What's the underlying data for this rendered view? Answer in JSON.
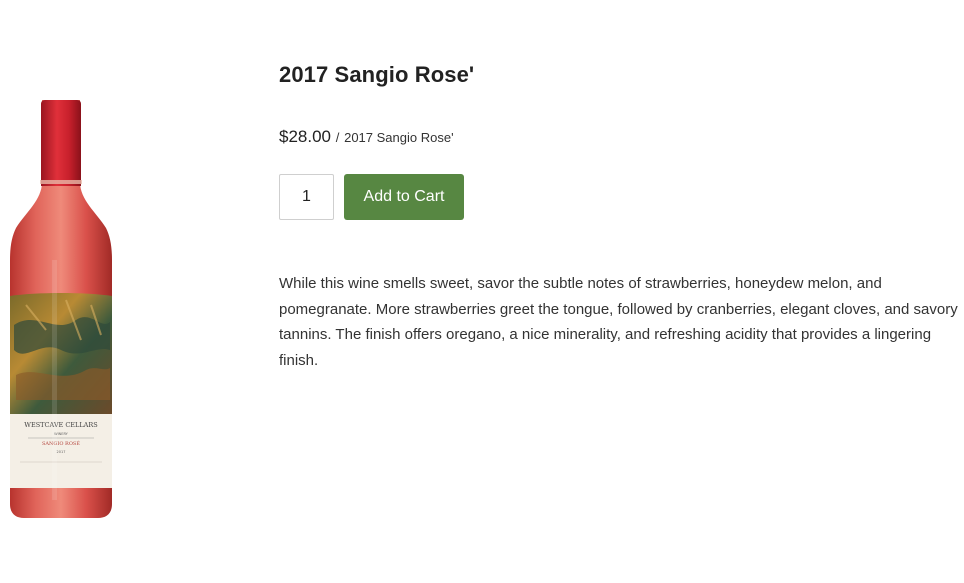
{
  "product": {
    "title": "2017 Sangio Rose'",
    "price": "$28.00",
    "price_separator": "/",
    "price_unit": "2017 Sangio Rose'",
    "quantity": "1",
    "add_to_cart_label": "Add to Cart",
    "description": "While this wine smells sweet, savor the subtle notes of strawberries, honeydew melon, and pomegranate. More strawberries greet the tongue, followed by cranberries, elegant cloves, and savory tannins. The finish offers oregano, a nice minerality, and refreshing acidity that provides a lingering finish."
  },
  "bottle_label": {
    "winery": "WESTCAVE CELLARS",
    "subline": "WINERY",
    "wine_name": "SANGIO ROSÉ",
    "vintage": "2017"
  },
  "colors": {
    "button": "#578742",
    "wine": "#d9504a",
    "capsule": "#c8202c"
  }
}
